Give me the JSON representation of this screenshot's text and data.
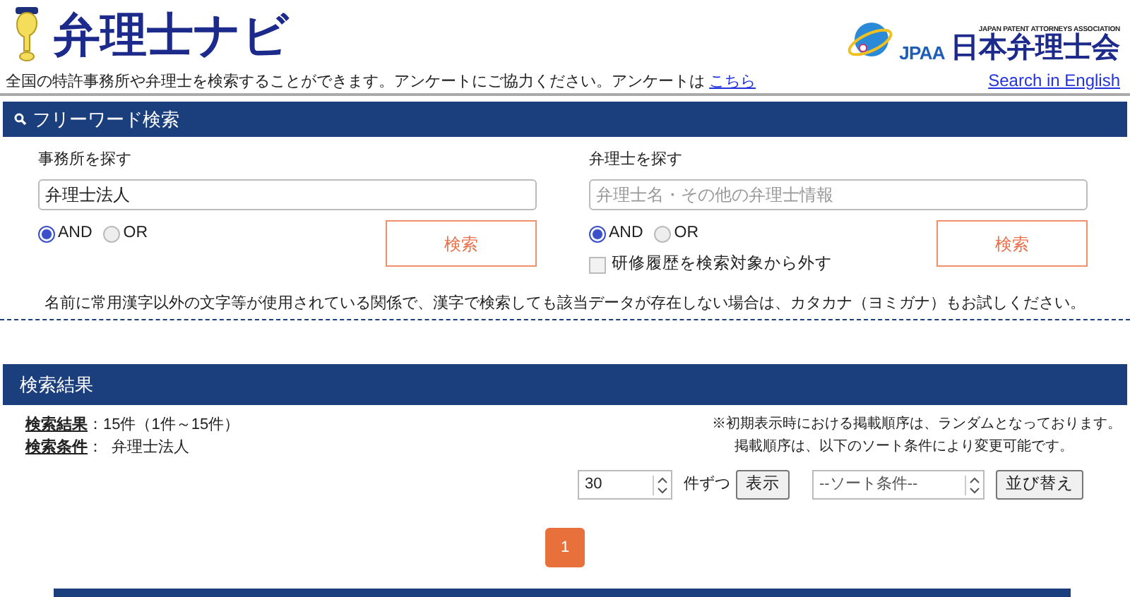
{
  "header": {
    "site_title": "弁理士ナビ",
    "description": "全国の特許事務所や弁理士を検索することができます。アンケートにご協力ください。アンケートは",
    "survey_link": "こちら",
    "association": {
      "tagline": "JAPAN PATENT ATTORNEYS ASSOCIATION",
      "abbr": "JPAA",
      "name": "日本弁理士会"
    },
    "english_link": "Search in English"
  },
  "free_word": {
    "title": "フリーワード検索",
    "panels": [
      {
        "label": "事務所を探す",
        "value": "弁理士法人",
        "options": [
          {
            "label": "AND",
            "selected": true
          },
          {
            "label": "OR",
            "selected": false
          }
        ],
        "button": "検索"
      },
      {
        "label": "弁理士を探す",
        "placeholder": "弁理士名・その他の弁理士情報",
        "options": [
          {
            "label": "AND",
            "selected": true
          },
          {
            "label": "OR",
            "selected": false
          }
        ],
        "checkbox": {
          "label": "研修履歴を検索対象から外す",
          "checked": false
        },
        "button": "検索"
      }
    ],
    "note": "名前に常用漢字以外の文字等が使用されている関係で、漢字で検索しても該当データが存在しない場合は、カタカナ（ヨミガナ）もお試しください。"
  },
  "results": {
    "title": "検索結果",
    "summary": [
      {
        "label": "検索結果",
        "value": "：15件（1件～15件）"
      },
      {
        "label": "検索条件",
        "value": "：  弁理士法人"
      }
    ],
    "notes": [
      "※初期表示時における掲載順序は、ランダムとなっております。",
      "掲載順序は、以下のソート条件により変更可能です。"
    ],
    "per_page": "30",
    "per_page_unit": "件ずつ",
    "show_button": "表示",
    "sort_select": "--ソート条件--",
    "sort_button": "並び替え",
    "pages": [
      {
        "label": "1",
        "selected": true
      }
    ]
  }
}
